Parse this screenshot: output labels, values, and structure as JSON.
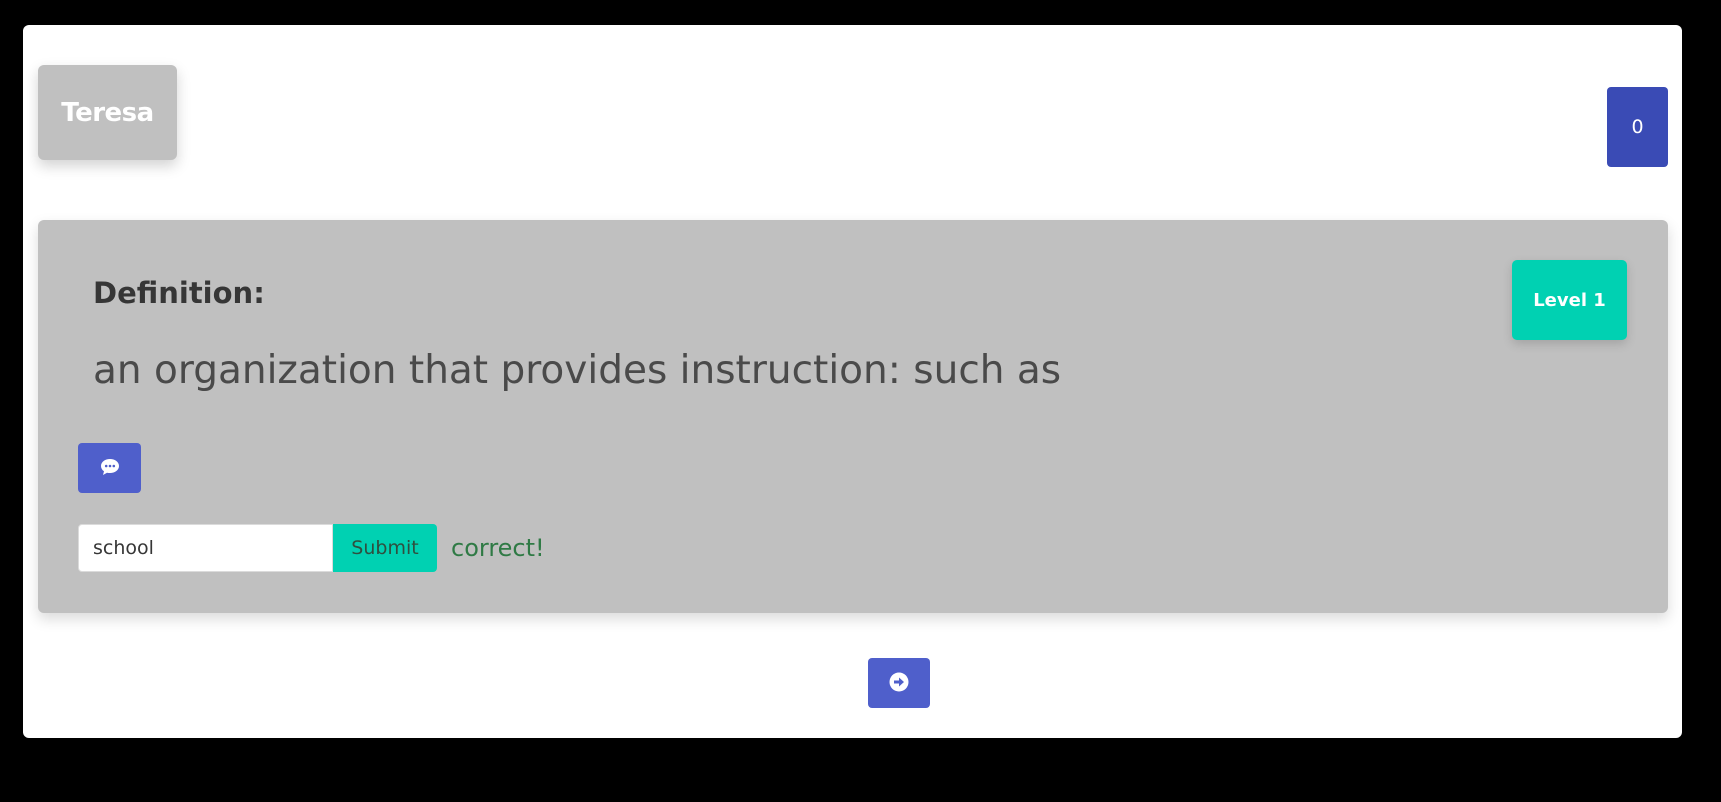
{
  "player": {
    "name": "Teresa"
  },
  "score": {
    "value": "0"
  },
  "card": {
    "heading": "Definition:",
    "definition": "an organization that provides instruction: such as",
    "level": "Level 1"
  },
  "answer": {
    "value": "school",
    "submit_label": "Submit",
    "result": "correct!"
  },
  "icons": {
    "hint": "speech-bubble-icon",
    "next": "arrow-circle-right-icon"
  },
  "colors": {
    "primary": "#3a4bb5",
    "button_blue": "#4f5fcb",
    "accent": "#00d1b2",
    "card_bg": "#c0c0c0",
    "success_text": "#2f7a45"
  }
}
